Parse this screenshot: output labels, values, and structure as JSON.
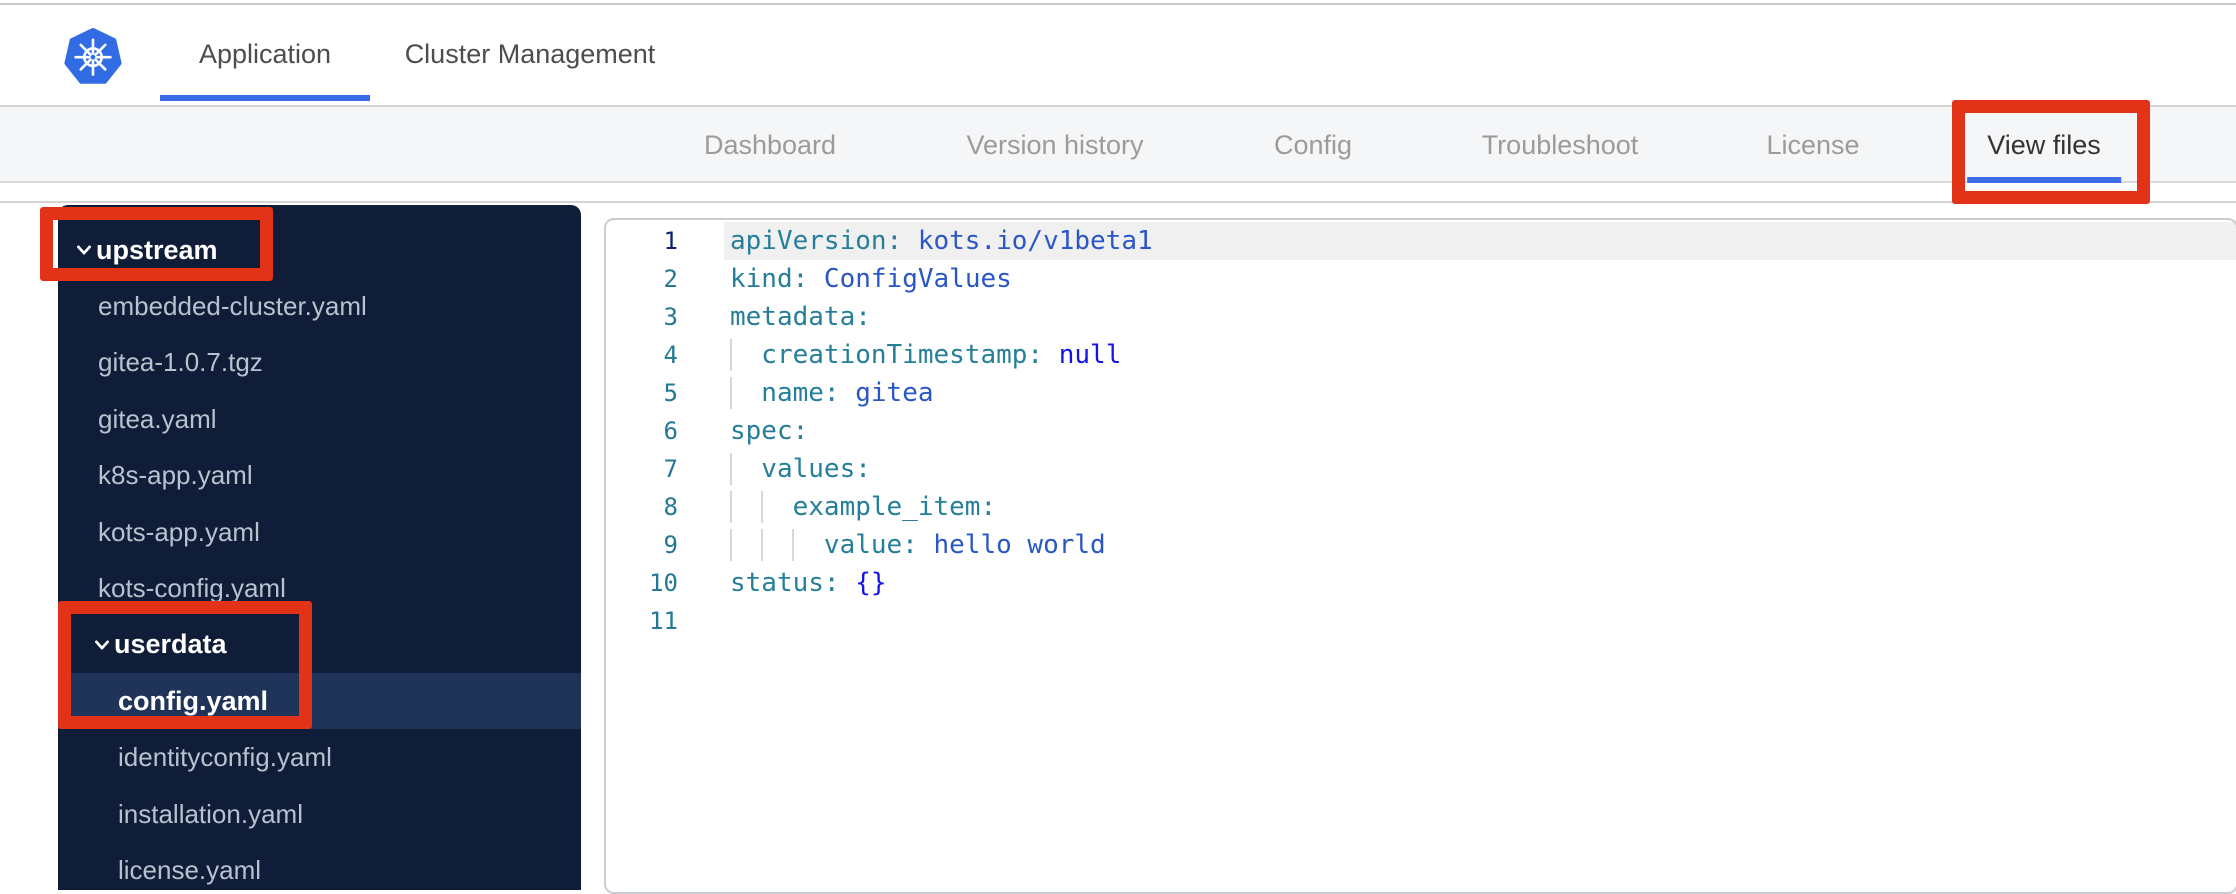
{
  "colors": {
    "accent": "#3b6ce5",
    "annotation_red": "#e23318",
    "topbar_text": "#4d4d4d",
    "subnav_bg": "#f5f6f8",
    "subnav_text": "#9b9b9b",
    "subnav_active_text": "#333333",
    "sidebar_bg": "#0f1d38",
    "sidebar_selected_bg": "#20345a",
    "sidebar_file_text": "#b9c1cf",
    "editor_border": "#c9ccd0",
    "token_key": "#267f99",
    "token_value": "#2a56c6",
    "token_keyword": "#1414e8",
    "line_number": "#237893",
    "active_line_number": "#0b216f",
    "active_line_bg": "#f0f0f1",
    "indent_guide": "#d8d8d8",
    "logo_blue": "#326ce5"
  },
  "topbar": {
    "logo": "kubernetes-logo",
    "tabs": [
      {
        "label": "Application",
        "active": true
      },
      {
        "label": "Cluster Management",
        "active": false
      }
    ]
  },
  "subnav": {
    "tabs": [
      {
        "label": "Dashboard",
        "active": false,
        "annotated": false
      },
      {
        "label": "Version history",
        "active": false,
        "annotated": false
      },
      {
        "label": "Config",
        "active": false,
        "annotated": false
      },
      {
        "label": "Troubleshoot",
        "active": false,
        "annotated": false
      },
      {
        "label": "License",
        "active": false,
        "annotated": false
      },
      {
        "label": "View files",
        "active": true,
        "annotated": true
      }
    ]
  },
  "sidebar": {
    "items": [
      {
        "label": "upstream",
        "kind": "folder",
        "level": 0,
        "expanded": true,
        "selected": false,
        "annotated": true
      },
      {
        "label": "embedded-cluster.yaml",
        "kind": "file",
        "level": 1,
        "selected": false,
        "annotated": false
      },
      {
        "label": "gitea-1.0.7.tgz",
        "kind": "file",
        "level": 1,
        "selected": false,
        "annotated": false
      },
      {
        "label": "gitea.yaml",
        "kind": "file",
        "level": 1,
        "selected": false,
        "annotated": false
      },
      {
        "label": "k8s-app.yaml",
        "kind": "file",
        "level": 1,
        "selected": false,
        "annotated": false
      },
      {
        "label": "kots-app.yaml",
        "kind": "file",
        "level": 1,
        "selected": false,
        "annotated": false
      },
      {
        "label": "kots-config.yaml",
        "kind": "file",
        "level": 1,
        "selected": false,
        "annotated": false
      },
      {
        "label": "userdata",
        "kind": "folder",
        "level": 1,
        "expanded": true,
        "selected": false,
        "annotated": true
      },
      {
        "label": "config.yaml",
        "kind": "file",
        "level": 2,
        "selected": true,
        "annotated": true
      },
      {
        "label": "identityconfig.yaml",
        "kind": "file",
        "level": 2,
        "selected": false,
        "annotated": false
      },
      {
        "label": "installation.yaml",
        "kind": "file",
        "level": 2,
        "selected": false,
        "annotated": false
      },
      {
        "label": "license.yaml",
        "kind": "file",
        "level": 2,
        "selected": false,
        "annotated": false
      }
    ]
  },
  "editor": {
    "lines": [
      {
        "n": "1",
        "active": true,
        "guides": 0,
        "segments": [
          {
            "t": "apiVersion:",
            "c": "key"
          },
          {
            "t": " kots.io/v1beta1",
            "c": "val"
          }
        ]
      },
      {
        "n": "2",
        "active": false,
        "guides": 0,
        "segments": [
          {
            "t": "kind:",
            "c": "key"
          },
          {
            "t": " ConfigValues",
            "c": "val"
          }
        ]
      },
      {
        "n": "3",
        "active": false,
        "guides": 0,
        "segments": [
          {
            "t": "metadata:",
            "c": "key"
          }
        ]
      },
      {
        "n": "4",
        "active": false,
        "guides": 1,
        "segments": [
          {
            "t": "  creationTimestamp:",
            "c": "key"
          },
          {
            "t": " null",
            "c": "kw"
          }
        ]
      },
      {
        "n": "5",
        "active": false,
        "guides": 1,
        "segments": [
          {
            "t": "  name:",
            "c": "key"
          },
          {
            "t": " gitea",
            "c": "val"
          }
        ]
      },
      {
        "n": "6",
        "active": false,
        "guides": 0,
        "segments": [
          {
            "t": "spec:",
            "c": "key"
          }
        ]
      },
      {
        "n": "7",
        "active": false,
        "guides": 1,
        "segments": [
          {
            "t": "  values:",
            "c": "key"
          }
        ]
      },
      {
        "n": "8",
        "active": false,
        "guides": 2,
        "segments": [
          {
            "t": "    example_item:",
            "c": "key"
          }
        ]
      },
      {
        "n": "9",
        "active": false,
        "guides": 3,
        "segments": [
          {
            "t": "      value:",
            "c": "key"
          },
          {
            "t": " hello world",
            "c": "val"
          }
        ]
      },
      {
        "n": "10",
        "active": false,
        "guides": 0,
        "segments": [
          {
            "t": "status:",
            "c": "key"
          },
          {
            "t": " ",
            "c": "plain"
          },
          {
            "t": "{}",
            "c": "kw"
          }
        ]
      },
      {
        "n": "11",
        "active": false,
        "guides": 0,
        "segments": []
      }
    ]
  }
}
